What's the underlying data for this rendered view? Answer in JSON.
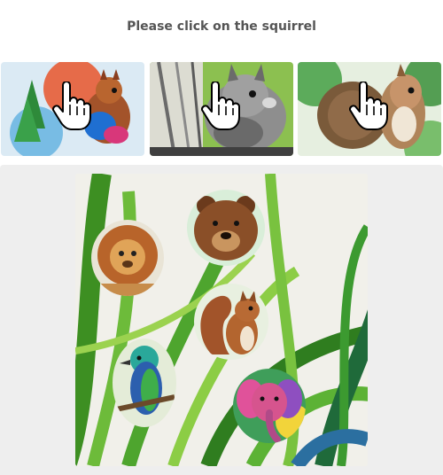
{
  "captcha": {
    "prompt": "Please click on the squirrel",
    "thumbnails": [
      {
        "subject": "squirrel",
        "style": "colorful watercolor"
      },
      {
        "subject": "squirrel",
        "style": "grey pencil"
      },
      {
        "subject": "squirrel",
        "style": "green watercolor"
      }
    ],
    "scene_animals": [
      "lion",
      "bear",
      "squirrel",
      "bird",
      "elephant"
    ]
  },
  "colors": {
    "prompt_text": "#555555",
    "panel_bg": "#eeeeee",
    "grass_green": "#4e9a2a"
  },
  "icons": {
    "pointer": "hand-pointer-icon"
  }
}
